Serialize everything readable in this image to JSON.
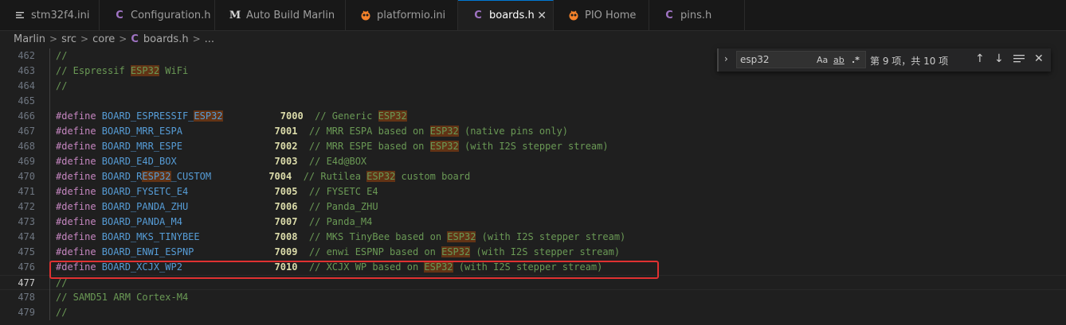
{
  "tabs": [
    {
      "label": "stm32f4.ini",
      "icon": "settings-file-icon",
      "active": false
    },
    {
      "label": "Configuration.h",
      "icon": "c-file-icon",
      "active": false
    },
    {
      "label": "Auto Build Marlin",
      "icon": "marlin-icon",
      "active": false
    },
    {
      "label": "platformio.ini",
      "icon": "platformio-icon",
      "active": false
    },
    {
      "label": "boards.h",
      "icon": "c-file-icon",
      "active": true
    },
    {
      "label": "PIO Home",
      "icon": "platformio-icon",
      "active": false
    },
    {
      "label": "pins.h",
      "icon": "c-file-icon",
      "active": false
    }
  ],
  "breadcrumb": [
    "Marlin",
    "src",
    "core",
    "boards.h",
    "..."
  ],
  "find": {
    "value": "esp32",
    "match_case_label": "Aa",
    "whole_word_label": "ab",
    "regex_label": ".*",
    "count": "第 9 项，共 10 项"
  },
  "lines": [
    {
      "n": "462",
      "parts": [
        [
          "cm",
          "//"
        ]
      ]
    },
    {
      "n": "463",
      "parts": [
        [
          "cm",
          "// Espressif "
        ],
        [
          "cmhl",
          "ESP32"
        ],
        [
          "cm",
          " WiFi"
        ]
      ]
    },
    {
      "n": "464",
      "parts": [
        [
          "cm",
          "//"
        ]
      ]
    },
    {
      "n": "465",
      "parts": []
    },
    {
      "n": "466",
      "parts": [
        [
          "kw",
          "#define "
        ],
        [
          "mac",
          "BOARD_ESPRESSIF_"
        ],
        [
          "machl",
          "ESP32"
        ],
        [
          "sp",
          "          "
        ],
        [
          "num",
          "7000"
        ],
        [
          "sp",
          "  "
        ],
        [
          "cm",
          "// Generic "
        ],
        [
          "cmhl",
          "ESP32"
        ]
      ]
    },
    {
      "n": "467",
      "parts": [
        [
          "kw",
          "#define "
        ],
        [
          "mac",
          "BOARD_MRR_ESPA"
        ],
        [
          "sp",
          "                "
        ],
        [
          "num",
          "7001"
        ],
        [
          "sp",
          "  "
        ],
        [
          "cm",
          "// MRR ESPA based on "
        ],
        [
          "cmhl",
          "ESP32"
        ],
        [
          "cm",
          " (native pins only)"
        ]
      ]
    },
    {
      "n": "468",
      "parts": [
        [
          "kw",
          "#define "
        ],
        [
          "mac",
          "BOARD_MRR_ESPE"
        ],
        [
          "sp",
          "                "
        ],
        [
          "num",
          "7002"
        ],
        [
          "sp",
          "  "
        ],
        [
          "cm",
          "// MRR ESPE based on "
        ],
        [
          "cmhl",
          "ESP32"
        ],
        [
          "cm",
          " (with I2S stepper stream)"
        ]
      ]
    },
    {
      "n": "469",
      "parts": [
        [
          "kw",
          "#define "
        ],
        [
          "mac",
          "BOARD_E4D_BOX"
        ],
        [
          "sp",
          "                 "
        ],
        [
          "num",
          "7003"
        ],
        [
          "sp",
          "  "
        ],
        [
          "cm",
          "// E4d@BOX"
        ]
      ]
    },
    {
      "n": "470",
      "parts": [
        [
          "kw",
          "#define "
        ],
        [
          "mac",
          "BOARD_R"
        ],
        [
          "machl",
          "ESP32"
        ],
        [
          "mac",
          "_CUSTOM"
        ],
        [
          "sp",
          "          "
        ],
        [
          "num",
          "7004"
        ],
        [
          "sp",
          "  "
        ],
        [
          "cm",
          "// Rutilea "
        ],
        [
          "cmhl",
          "ESP32"
        ],
        [
          "cm",
          " custom board"
        ]
      ]
    },
    {
      "n": "471",
      "parts": [
        [
          "kw",
          "#define "
        ],
        [
          "mac",
          "BOARD_FYSETC_E4"
        ],
        [
          "sp",
          "               "
        ],
        [
          "num",
          "7005"
        ],
        [
          "sp",
          "  "
        ],
        [
          "cm",
          "// FYSETC E4"
        ]
      ]
    },
    {
      "n": "472",
      "parts": [
        [
          "kw",
          "#define "
        ],
        [
          "mac",
          "BOARD_PANDA_ZHU"
        ],
        [
          "sp",
          "               "
        ],
        [
          "num",
          "7006"
        ],
        [
          "sp",
          "  "
        ],
        [
          "cm",
          "// Panda_ZHU"
        ]
      ]
    },
    {
      "n": "473",
      "parts": [
        [
          "kw",
          "#define "
        ],
        [
          "mac",
          "BOARD_PANDA_M4"
        ],
        [
          "sp",
          "                "
        ],
        [
          "num",
          "7007"
        ],
        [
          "sp",
          "  "
        ],
        [
          "cm",
          "// Panda_M4"
        ]
      ]
    },
    {
      "n": "474",
      "parts": [
        [
          "kw",
          "#define "
        ],
        [
          "mac",
          "BOARD_MKS_TINYBEE"
        ],
        [
          "sp",
          "             "
        ],
        [
          "num",
          "7008"
        ],
        [
          "sp",
          "  "
        ],
        [
          "cm",
          "// MKS TinyBee based on "
        ],
        [
          "cmhl",
          "ESP32"
        ],
        [
          "cm",
          " (with I2S stepper stream)"
        ]
      ]
    },
    {
      "n": "475",
      "parts": [
        [
          "kw",
          "#define "
        ],
        [
          "mac",
          "BOARD_ENWI_ESPNP"
        ],
        [
          "sp",
          "              "
        ],
        [
          "num",
          "7009"
        ],
        [
          "sp",
          "  "
        ],
        [
          "cm",
          "// enwi ESPNP based on "
        ],
        [
          "cmhl",
          "ESP32"
        ],
        [
          "cm",
          " (with I2S stepper stream)"
        ]
      ]
    },
    {
      "n": "476",
      "parts": [
        [
          "kw",
          "#define "
        ],
        [
          "mac",
          "BOARD_XCJX_WP2"
        ],
        [
          "sp",
          "                "
        ],
        [
          "num",
          "7010"
        ],
        [
          "sp",
          "  "
        ],
        [
          "cm",
          "// XCJX WP based on "
        ],
        [
          "cmhl",
          "ESP32"
        ],
        [
          "cm",
          " (with I2S stepper stream)"
        ]
      ]
    },
    {
      "n": "477",
      "parts": [
        [
          "cm",
          "//"
        ]
      ],
      "current": true
    },
    {
      "n": "478",
      "parts": [
        [
          "cm",
          "// SAMD51 ARM Cortex-M4"
        ]
      ]
    },
    {
      "n": "479",
      "parts": [
        [
          "cm",
          "//"
        ]
      ]
    }
  ],
  "colors": {
    "highlight": "#623315",
    "annotation": "#e03131",
    "accent": "#0078d4"
  }
}
